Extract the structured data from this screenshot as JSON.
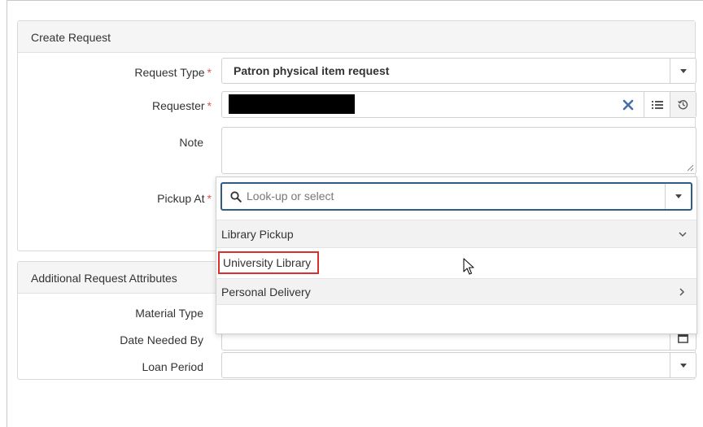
{
  "create_request": {
    "title": "Create Request",
    "request_type": {
      "label": "Request Type",
      "required": "*",
      "value": "Patron physical item request"
    },
    "requester": {
      "label": "Requester",
      "required": "*"
    },
    "note": {
      "label": "Note"
    },
    "pickup_at": {
      "label": "Pickup At",
      "required": "*",
      "placeholder": "Look-up or select"
    }
  },
  "pickup_dropdown": {
    "groups": [
      {
        "label": "Library Pickup",
        "expanded": true
      },
      {
        "label": "Personal Delivery",
        "expanded": false
      }
    ],
    "options": [
      {
        "label": "University Library",
        "highlighted": true
      }
    ]
  },
  "additional": {
    "title": "Additional Request Attributes",
    "material_type": {
      "label": "Material Type"
    },
    "date_needed_by": {
      "label": "Date Needed By"
    },
    "loan_period": {
      "label": "Loan Period"
    }
  },
  "icons": {
    "clear": "close-icon",
    "list": "list-icon",
    "history": "history-icon",
    "search": "search-icon",
    "calendar": "calendar-icon",
    "caret": "chevron-down-icon"
  },
  "colors": {
    "required": "#d9534f",
    "highlight_border": "#d9302c",
    "focus_border": "#2f5d86",
    "clear_icon": "#4a6fa5"
  }
}
